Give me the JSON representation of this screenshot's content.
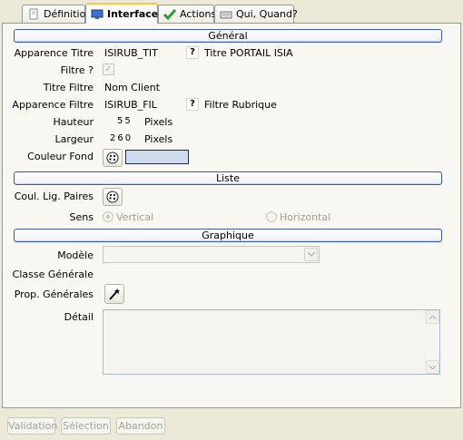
{
  "tabs": [
    {
      "label": "Définition",
      "icon": "document-icon",
      "active": false
    },
    {
      "label": "Interface",
      "icon": "monitor-icon",
      "active": true
    },
    {
      "label": "Actions",
      "icon": "checkmark-icon",
      "active": false
    },
    {
      "label": "Qui, Quand?",
      "icon": "keyboard-icon",
      "active": false
    }
  ],
  "sections": {
    "general": "Général",
    "liste": "Liste",
    "graphique": "Graphique"
  },
  "general": {
    "apparence_titre_label": "Apparence Titre",
    "apparence_titre_value": "ISIRUB_TIT",
    "titre_help": "?",
    "titre_portail": "Titre PORTAIL ISIA",
    "filtre_label": "Filtre ?",
    "filtre_checked": "✓",
    "titre_filtre_label": "Titre Filtre",
    "titre_filtre_value": "Nom Client",
    "apparence_filtre_label": "Apparence Filtre",
    "apparence_filtre_value": "ISIRUB_FIL",
    "filtre_help": "?",
    "filtre_rubrique": "Filtre Rubrique",
    "hauteur_label": "Hauteur",
    "hauteur_value": "55",
    "hauteur_unit": "Pixels",
    "largeur_label": "Largeur",
    "largeur_value": "260",
    "largeur_unit": "Pixels",
    "couleur_fond_label": "Couleur Fond",
    "couleur_fond_color": "#cfdbef"
  },
  "liste": {
    "coul_lig_label": "Coul. Lig. Paires",
    "sens_label": "Sens",
    "vertical": "Vertical",
    "horizontal": "Horizontal"
  },
  "graphique": {
    "modele_label": "Modèle",
    "classe_label": "Classe Générale",
    "prop_label": "Prop. Générales",
    "detail_label": "Détail"
  },
  "buttons": {
    "validation": "Validation",
    "selection": "Sélection",
    "abandon": "Abandon"
  },
  "colors": {
    "section_border": "#3a5ba6",
    "active_tab_accent": "#ffc83c"
  }
}
